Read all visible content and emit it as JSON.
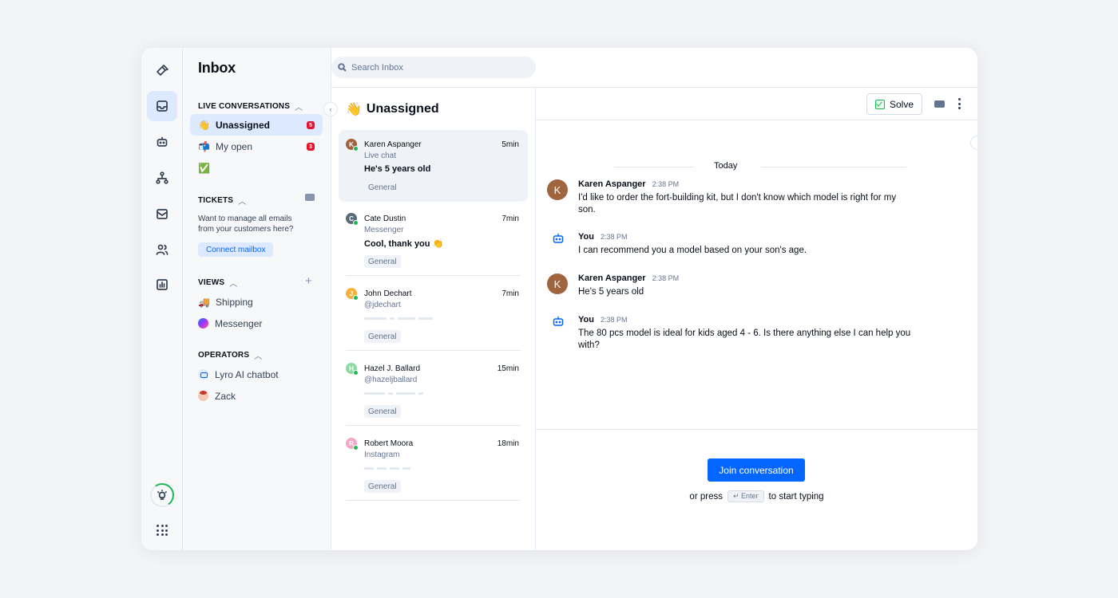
{
  "sidebar": {
    "title": "Inbox",
    "live_conversations": {
      "label": "LIVE CONVERSATIONS",
      "items": [
        {
          "icon": "👋",
          "label": "Unassigned",
          "badge": "5"
        },
        {
          "icon": "📬",
          "label": "My open",
          "badge": "3"
        },
        {
          "icon": "✅",
          "label": ""
        }
      ]
    },
    "tickets": {
      "label": "TICKETS",
      "text": "Want to manage all emails from your customers here?",
      "connect_label": "Connect mailbox"
    },
    "views": {
      "label": "VIEWS",
      "items": [
        {
          "icon": "🚚",
          "label": "Shipping"
        },
        {
          "icon": "messenger-icon",
          "label": "Messenger"
        }
      ]
    },
    "operators": {
      "label": "OPERATORS",
      "items": [
        {
          "icon": "bot-icon",
          "label": "Lyro AI chatbot"
        },
        {
          "icon": "avatar",
          "label": "Zack"
        }
      ]
    }
  },
  "search": {
    "placeholder": "Search Inbox"
  },
  "list": {
    "title_emoji": "👋",
    "title": "Unassigned",
    "conversations": [
      {
        "initial": "K",
        "color": "#a0643f",
        "name": "Karen Aspanger",
        "time": "5min",
        "channel": "Live chat",
        "message": "He's 5 years old",
        "tag": "General"
      },
      {
        "initial": "C",
        "color": "#5b6b78",
        "name": "Cate Dustin",
        "time": "7min",
        "channel": "Messenger",
        "message": "Cool, thank you 👏",
        "tag": "General"
      },
      {
        "initial": "J",
        "color": "#f7b23b",
        "name": "John Dechart",
        "time": "7min",
        "channel": "@jdechart",
        "message": "",
        "tag": "General"
      },
      {
        "initial": "H",
        "color": "#8ed9a3",
        "name": "Hazel J. Ballard",
        "time": "15min",
        "channel": "@hazeljballard",
        "message": "",
        "tag": "General"
      },
      {
        "initial": "R",
        "color": "#f5a7c7",
        "name": "Robert Moora",
        "time": "18min",
        "channel": "Instagram",
        "message": "",
        "tag": "General"
      }
    ]
  },
  "chat": {
    "solve_label": "Solve",
    "day_label": "Today",
    "messages": [
      {
        "author": "Karen Aspanger",
        "initial": "K",
        "time": "2:38 PM",
        "text": "I'd like to order the fort-building kit, but I don't know which model is right for my son."
      },
      {
        "author": "You",
        "time": "2:38 PM",
        "text": "I can recommend you a model based on your son's age."
      },
      {
        "author": "Karen Aspanger",
        "initial": "K",
        "time": "2:38 PM",
        "text": "He's 5 years old"
      },
      {
        "author": "You",
        "time": "2:38 PM",
        "text": "The 80 pcs model is ideal for kids aged 4 - 6. Is there anything else I can help you with?"
      }
    ],
    "join_label": "Join conversation",
    "press_before": "or press",
    "press_key": "↵ Enter",
    "press_after": "to start typing"
  }
}
